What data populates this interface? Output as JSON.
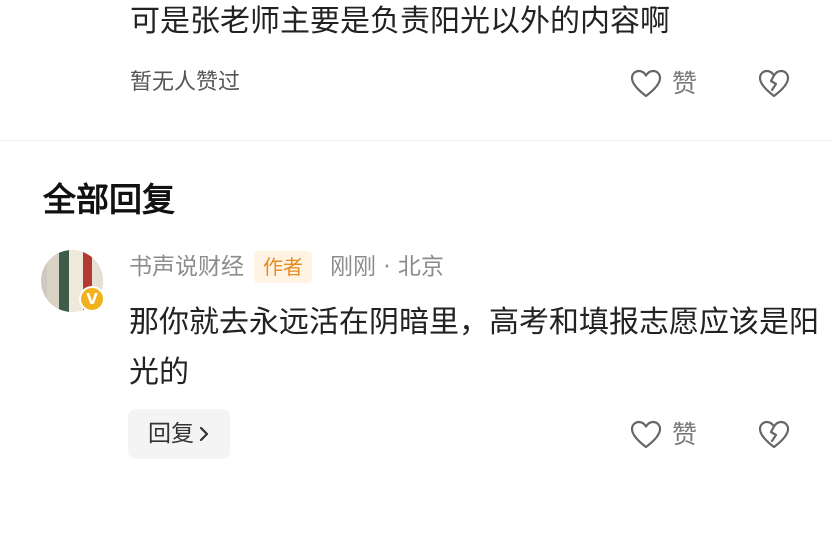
{
  "previous_comment": {
    "text": "可是张老师主要是负责阳光以外的内容啊",
    "likes_summary": "暂无人赞过",
    "like_label": "赞"
  },
  "section": {
    "title": "全部回复"
  },
  "reply": {
    "username": "书声说财经",
    "author_tag": "作者",
    "time_location": "刚刚 · 北京",
    "content": "那你就去永远活在阴暗里，高考和填报志愿应该是阳光的",
    "reply_button_label": "回复",
    "like_label": "赞",
    "verified_badge": "V"
  },
  "icons": {
    "like": "heart-outline-icon",
    "dislike": "broken-heart-icon",
    "chevron": "chevron-right-icon"
  },
  "colors": {
    "text_primary": "#222222",
    "text_secondary": "#8c8c8c",
    "author_tag_bg": "#fff3e3",
    "author_tag_text": "#e78a22",
    "badge": "#f2b21d"
  }
}
